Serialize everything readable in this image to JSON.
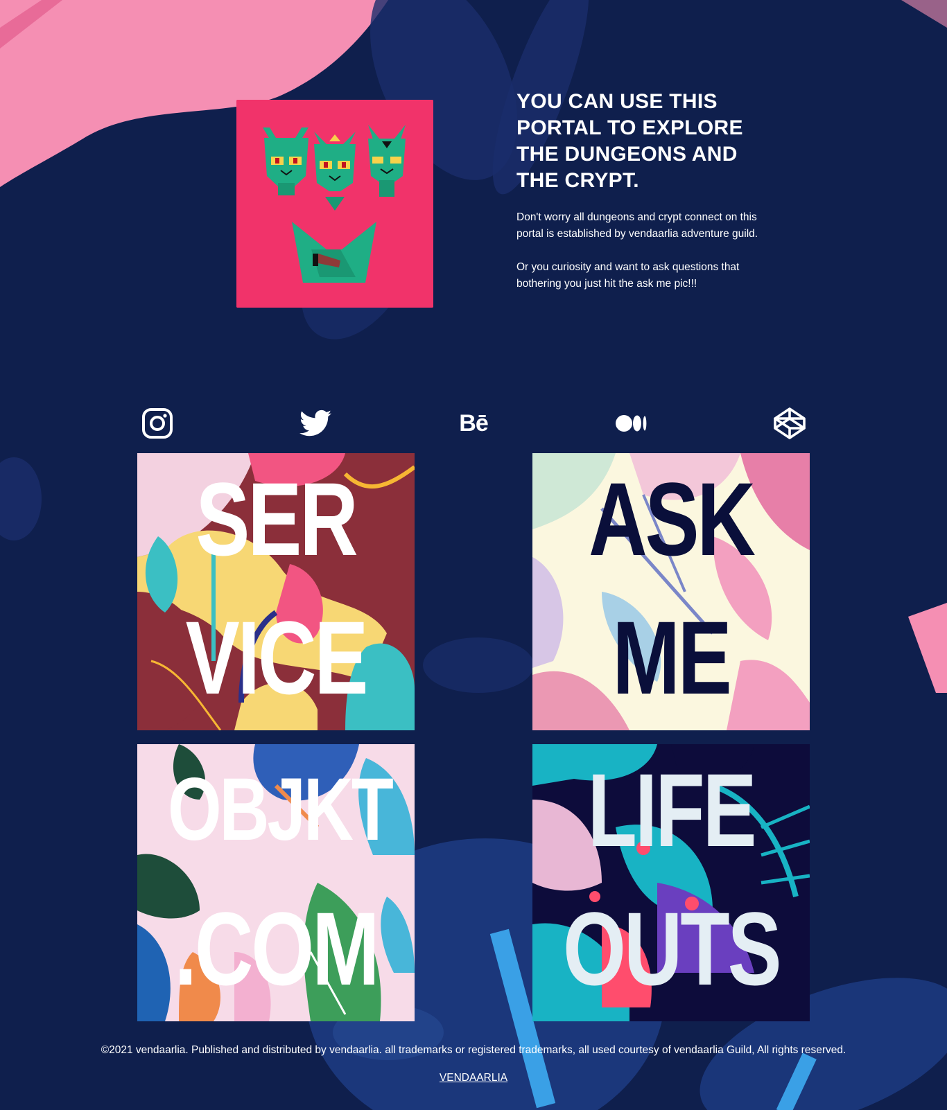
{
  "hero": {
    "title": "YOU CAN USE THIS PORTAL TO EXPLORE THE DUNGEONS AND THE CRYPT.",
    "paragraph_1": "Don't worry all dungeons and crypt connect on this portal is established by vendaarlia adventure guild.",
    "paragraph_2": "Or you curiosity and want to ask questions that bothering you just hit the ask me pic!!!",
    "image_icon": "three-cat-heads-illustration"
  },
  "socials": [
    {
      "icon": "instagram-icon"
    },
    {
      "icon": "twitter-icon"
    },
    {
      "icon": "behance-icon",
      "text": "Bē"
    },
    {
      "icon": "medium-icon"
    },
    {
      "icon": "codepen-icon"
    }
  ],
  "tiles": [
    {
      "line_1": "SER",
      "line_2": "VICE"
    },
    {
      "line_1": "ASK",
      "line_2": "ME"
    },
    {
      "line_1": "OBJKT",
      "line_2": ".COM"
    },
    {
      "line_1": "LIFE",
      "line_2": "OUTS"
    }
  ],
  "footer": {
    "copyright": "©2021 vendaarlia. Published and distributed by vendaarlia. all trademarks or registered trademarks, all used courtesy of vendaarlia Guild, All rights reserved.",
    "link": "VENDAARLIA"
  },
  "colors": {
    "background": "#0f1f4d",
    "hero_art_bg": "#f1336a",
    "cat_green": "#1fae85",
    "brush_pink": "#f58fb3"
  }
}
